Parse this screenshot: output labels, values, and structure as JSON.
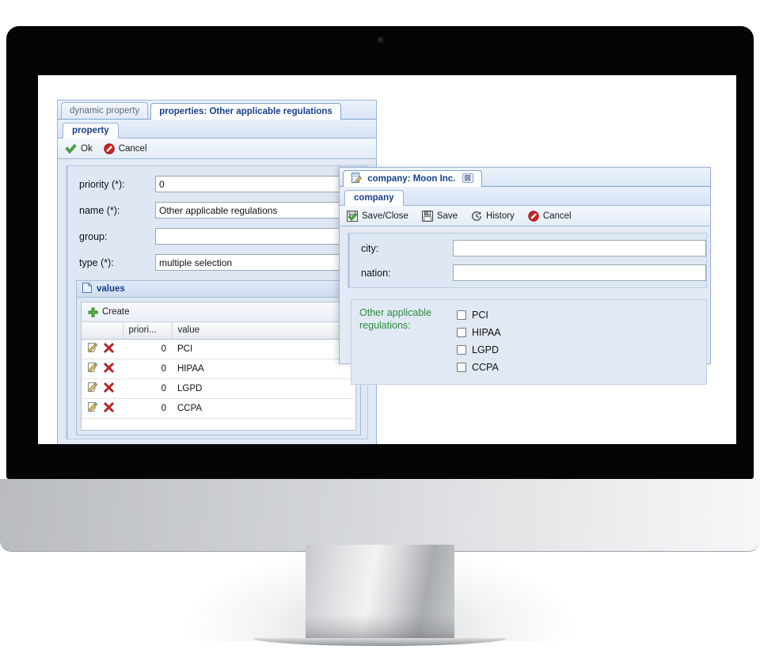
{
  "left_window": {
    "tabs": [
      {
        "label": "dynamic property",
        "active": false
      },
      {
        "label": "properties: Other applicable regulations",
        "active": true
      }
    ],
    "subtab": "property",
    "toolbar": [
      {
        "label": "Ok",
        "icon": "check-icon"
      },
      {
        "label": "Cancel",
        "icon": "cancel-icon"
      }
    ],
    "form": [
      {
        "label": "priority (*):",
        "value": "0"
      },
      {
        "label": "name (*):",
        "value": "Other applicable regulations"
      },
      {
        "label": "group:",
        "value": ""
      },
      {
        "label": "type (*):",
        "value": "multiple selection"
      }
    ],
    "values_panel": {
      "title": "values",
      "title_icon": "page-icon",
      "create_label": "Create",
      "create_icon": "plus-icon",
      "columns": [
        "",
        "priori...",
        "value"
      ],
      "rows": [
        {
          "priority": "0",
          "value": "PCI"
        },
        {
          "priority": "0",
          "value": "HIPAA"
        },
        {
          "priority": "0",
          "value": "LGPD"
        },
        {
          "priority": "0",
          "value": "CCPA"
        }
      ],
      "row_icons": [
        "edit-icon",
        "delete-icon"
      ]
    }
  },
  "right_window": {
    "tab": {
      "label": "company: Moon Inc.",
      "icon": "record-edit-icon",
      "close": "☒"
    },
    "subtab": "company",
    "toolbar": [
      {
        "label": "Save/Close",
        "icon": "save-close-icon"
      },
      {
        "label": "Save",
        "icon": "floppy-icon"
      },
      {
        "label": "History",
        "icon": "history-icon"
      },
      {
        "label": "Cancel",
        "icon": "cancel-icon"
      }
    ],
    "form": [
      {
        "label": "city:",
        "value": ""
      },
      {
        "label": "nation:",
        "value": ""
      }
    ],
    "regulations": {
      "label": "Other applicable regulations:",
      "label_color": "#2e8b3d",
      "options": [
        {
          "label": "PCI",
          "checked": false
        },
        {
          "label": "HIPAA",
          "checked": false
        },
        {
          "label": "LGPD",
          "checked": false
        },
        {
          "label": "CCPA",
          "checked": false
        }
      ]
    }
  }
}
